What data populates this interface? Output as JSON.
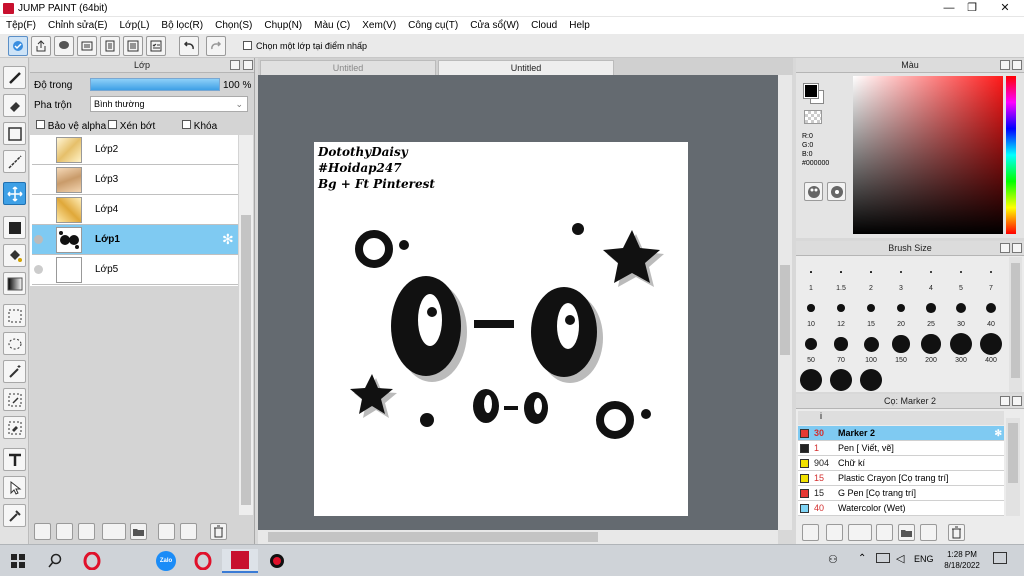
{
  "app": {
    "title": "JUMP PAINT (64bit)"
  },
  "window_controls": {
    "minimize": "—",
    "maximize": "❐",
    "close": "✕"
  },
  "menu": [
    "Tệp(F)",
    "Chỉnh sửa(E)",
    "Lớp(L)",
    "Bộ lọc(R)",
    "Chọn(S)",
    "Chụp(N)",
    "Màu (C)",
    "Xem(V)",
    "Công cụ(T)",
    "Cửa sổ(W)",
    "Cloud",
    "Help"
  ],
  "toolbar": {
    "checkbox_label": "Chọn một lớp tại điểm nhấp"
  },
  "layer_panel": {
    "title": "Lớp",
    "opacity_label": "Độ trong",
    "opacity_value": "100 %",
    "opacity_fraction": 1.0,
    "blend_label": "Pha trộn",
    "blend_value": "Bình thường",
    "protect_alpha": "Bảo vệ alpha",
    "clipping": "Xén bớt",
    "lock": "Khóa",
    "layers": [
      {
        "name": "Lớp2",
        "selected": false
      },
      {
        "name": "Lớp3",
        "selected": false
      },
      {
        "name": "Lớp4",
        "selected": false
      },
      {
        "name": "Lớp1",
        "selected": true
      },
      {
        "name": "Lớp5",
        "selected": false
      }
    ]
  },
  "tabs": [
    {
      "label": "Untitled",
      "active": false
    },
    {
      "label": "Untitled",
      "active": true
    }
  ],
  "canvas": {
    "text_lines": [
      "DotothyDaisy",
      "#Hoidap247",
      "Bg + Ft Pinterest"
    ],
    "main_face": "ʘ‿ʘ"
  },
  "color_panel": {
    "title": "Màu",
    "r": "R:0",
    "g": "G:0",
    "b": "B:0",
    "hex": "#000000",
    "accent": "#000000"
  },
  "brush_panel": {
    "title": "Brush Size",
    "sizes": [
      "1",
      "1.5",
      "2",
      "3",
      "4",
      "5",
      "7",
      "10",
      "12",
      "15",
      "20",
      "25",
      "30",
      "40",
      "50",
      "70",
      "100",
      "150",
      "200",
      "300",
      "400",
      "",
      "",
      ""
    ]
  },
  "marker_panel": {
    "title": "Cọ: Marker 2",
    "items": [
      {
        "size": "30",
        "name": "Marker 2",
        "color": "#e53935",
        "selected": true
      },
      {
        "size": "1",
        "name": "Pen [ Viết, vẽ]",
        "color": "#222222",
        "selected": false
      },
      {
        "size": "904",
        "name": "Chữ kí",
        "color": "#f2e200",
        "selected": false
      },
      {
        "size": "15",
        "name": "Plastic Crayon [Cọ trang trí]",
        "color": "#f2e200",
        "selected": false
      },
      {
        "size": "15",
        "name": "G Pen [Cọ trang trí]",
        "color": "#e53935",
        "selected": false
      },
      {
        "size": "40",
        "name": "Watercolor (Wet)",
        "color": "#7fd4f5",
        "selected": false
      }
    ]
  },
  "taskbar": {
    "time": "1:28 PM",
    "date": "8/18/2022",
    "lang": "ENG",
    "zalo": "Zalo"
  }
}
